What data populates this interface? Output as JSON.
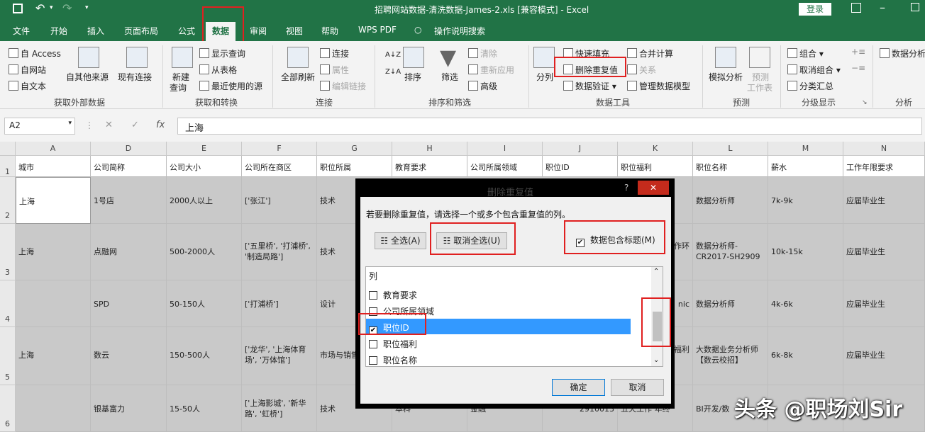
{
  "window": {
    "title": "招聘网站数据-清洗数据-James-2.xls  [兼容模式]  -  Excel",
    "login": "登录"
  },
  "tabs": [
    "文件",
    "开始",
    "插入",
    "页面布局",
    "公式",
    "数据",
    "审阅",
    "视图",
    "帮助",
    "WPS PDF",
    "操作说明搜索"
  ],
  "ribbon": {
    "ext": {
      "access": "自 Access",
      "web": "自网站",
      "text": "自文本",
      "other": "自其他来源",
      "existing": "现有连接",
      "group": "获取外部数据"
    },
    "transform": {
      "new_query": "新建",
      "new_query2": "查询",
      "show": "显示查询",
      "table": "从表格",
      "recent": "最近使用的源",
      "group": "获取和转换"
    },
    "conn": {
      "refresh": "全部刷新",
      "connections": "连接",
      "props": "属性",
      "edit": "编辑链接",
      "group": "连接"
    },
    "sort": {
      "sort": "排序",
      "filter": "筛选",
      "clear": "清除",
      "reapply": "重新应用",
      "advanced": "高级",
      "group": "排序和筛选"
    },
    "tools": {
      "split": "分列",
      "flash": "快速填充",
      "remove_dup": "删除重复值",
      "validate": "数据验证",
      "consolidate": "合并计算",
      "relation": "关系",
      "model": "管理数据模型",
      "group": "数据工具"
    },
    "forecast": {
      "whatif": "模拟分析",
      "sheet": "预测",
      "sheet2": "工作表",
      "group": "预测"
    },
    "outline": {
      "group_btn": "组合",
      "ungroup": "取消组合",
      "subtotal": "分类汇总",
      "group": "分级显示"
    },
    "analysis": {
      "btn": "数据分析",
      "group": "分析"
    }
  },
  "formula": {
    "namebox": "A2",
    "value": "上海"
  },
  "columns": [
    "A",
    "D",
    "E",
    "F",
    "G",
    "H",
    "I",
    "J",
    "K",
    "L",
    "M",
    "N"
  ],
  "header_row": [
    "城市",
    "公司简称",
    "公司大小",
    "公司所在商区",
    "职位所属",
    "教育要求",
    "公司所属领域",
    "职位ID",
    "职位福利",
    "职位名称",
    "薪水",
    "工作年限要求"
  ],
  "rows": [
    {
      "n": "2",
      "A": "上海",
      "D": "1号店",
      "E": "2000人以上",
      "F": "['张江']",
      "G": "技术",
      "K": "",
      "L": "数据分析师",
      "M": "7k-9k",
      "N": "应届毕业生"
    },
    {
      "n": "3",
      "A": "上海",
      "D": "点融网",
      "E": "500-2000人",
      "F": "['五里桥', '打浦桥', '制造局路']",
      "G": "技术",
      "K": "好,作环",
      "L": "数据分析师-CR2017-SH2909",
      "M": "10k-15k",
      "N": "应届毕业生"
    },
    {
      "n": "4",
      "A": "",
      "D": "SPD",
      "E": "50-150人",
      "F": "['打浦桥']",
      "G": "设计",
      "K": "nic",
      "L": "数据分析师",
      "M": "4k-6k",
      "N": "应届毕业生"
    },
    {
      "n": "5",
      "A": "上海",
      "D": "数云",
      "E": "150-500人",
      "F": "['龙华', '上海体育场', '万体馆']",
      "G": "市场与销售",
      "K": "奖金福利",
      "L": "大数据业务分析师【数云校招】",
      "M": "6k-8k",
      "N": "应届毕业生"
    },
    {
      "n": "6",
      "A": "",
      "D": "银基富力",
      "E": "15-50人",
      "F": "['上海影城', '新华路', '虹桥']",
      "G": "技术",
      "H": "本科",
      "I": "金融",
      "J": "2910013",
      "K": "五天工作 年终",
      "L": "BI开发/数",
      "M": "",
      "N": ""
    }
  ],
  "dialog": {
    "title": "删除重复值",
    "help": "?",
    "close": "✕",
    "prompt": "若要删除重复值，请选择一个或多个包含重复值的列。",
    "select_all": "全选(A)",
    "unselect_all": "取消全选(U)",
    "has_header": "数据包含标题(M)",
    "list_header": "列",
    "items": [
      {
        "label": "教育要求",
        "checked": false
      },
      {
        "label": "公司所属领域",
        "checked": false
      },
      {
        "label": "职位ID",
        "checked": true
      },
      {
        "label": "职位福利",
        "checked": false
      },
      {
        "label": "职位名称",
        "checked": false
      }
    ],
    "ok": "确定",
    "cancel": "取消"
  },
  "watermark": "头条 @职场刘Sir"
}
